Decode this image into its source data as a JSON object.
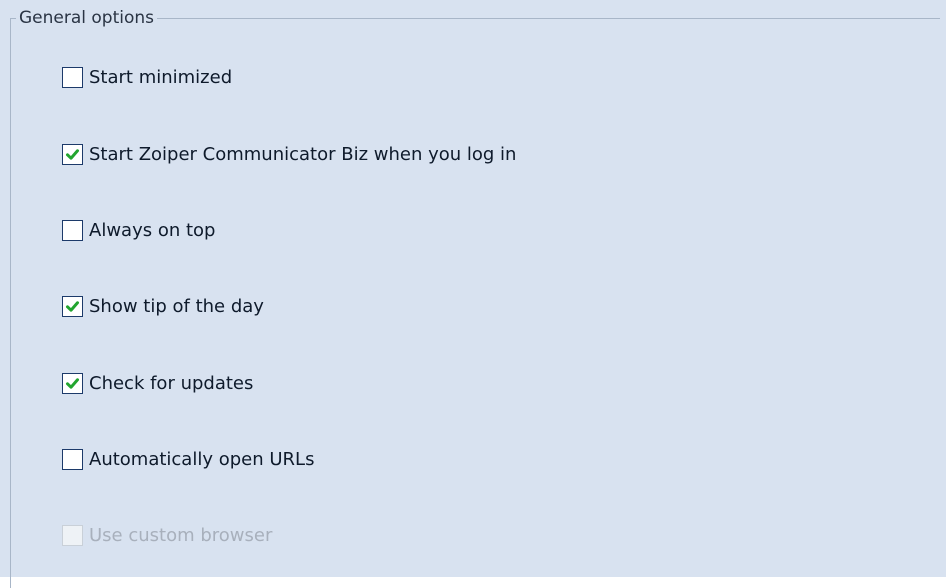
{
  "group": {
    "title": "General options"
  },
  "options": [
    {
      "label": "Start minimized",
      "checked": false,
      "enabled": true
    },
    {
      "label": "Start Zoiper Communicator Biz when you log in",
      "checked": true,
      "enabled": true
    },
    {
      "label": "Always on top",
      "checked": false,
      "enabled": true
    },
    {
      "label": "Show tip of the day",
      "checked": true,
      "enabled": true
    },
    {
      "label": "Check for updates",
      "checked": true,
      "enabled": true
    },
    {
      "label": "Automatically open URLs",
      "checked": false,
      "enabled": true
    },
    {
      "label": "Use custom browser",
      "checked": false,
      "enabled": false
    }
  ],
  "colors": {
    "panel_background": "#d8e2f0",
    "checkmark": "#22a52f",
    "disabled_text": "#a8b0bc"
  }
}
